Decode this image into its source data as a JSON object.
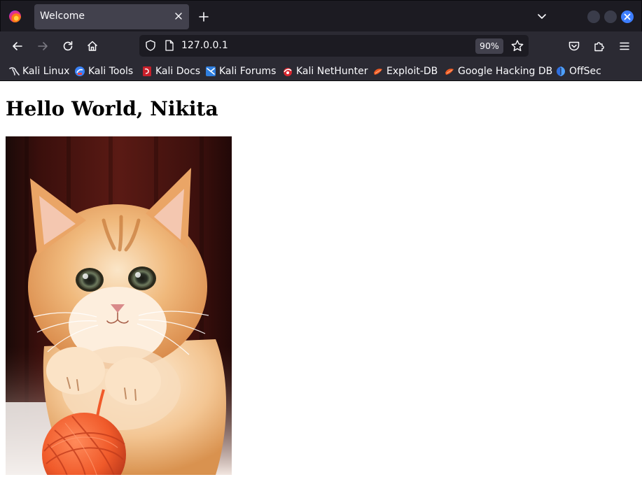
{
  "browser": {
    "tab": {
      "title": "Welcome"
    },
    "url": "127.0.0.1",
    "zoom": "90%",
    "bookmarks": [
      {
        "label": "Kali Linux",
        "icon": "kali-dragon-icon"
      },
      {
        "label": "Kali Tools",
        "icon": "kali-tools-icon"
      },
      {
        "label": "Kali Docs",
        "icon": "kali-docs-icon"
      },
      {
        "label": "Kali Forums",
        "icon": "kali-forums-icon"
      },
      {
        "label": "Kali NetHunter",
        "icon": "nethunter-icon"
      },
      {
        "label": "Exploit-DB",
        "icon": "exploit-db-icon"
      },
      {
        "label": "Google Hacking DB",
        "icon": "ghdb-icon"
      },
      {
        "label": "OffSec",
        "icon": "offsec-icon"
      }
    ]
  },
  "page": {
    "heading": "Hello World, Nikita",
    "image": {
      "subject": "kitten-with-yarn"
    }
  },
  "colors": {
    "chrome_dark": "#1c1b22",
    "chrome_mid": "#2b2a33",
    "tab_active": "#42414d",
    "close_blue": "#3d7eff",
    "yarn": "#f05a2a"
  }
}
